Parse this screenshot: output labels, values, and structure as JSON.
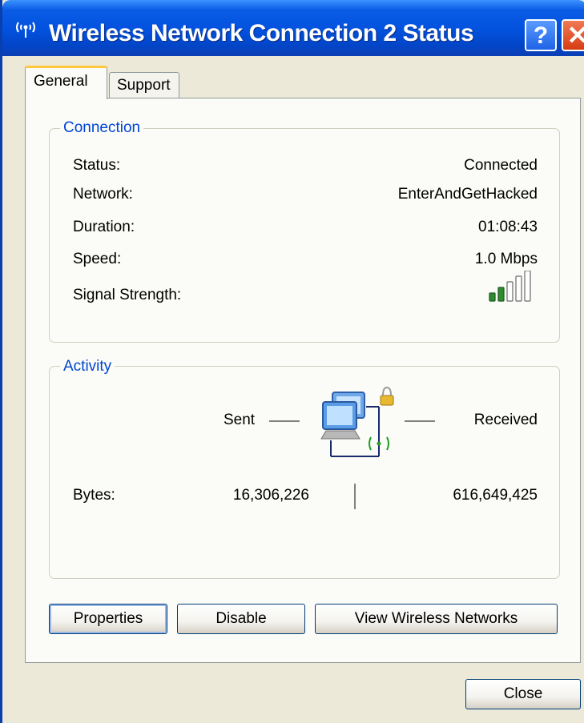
{
  "window": {
    "title": "Wireless Network Connection 2 Status",
    "help_label": "?",
    "close_label": "✕"
  },
  "tabs": [
    {
      "label": "General",
      "active": true
    },
    {
      "label": "Support",
      "active": false
    }
  ],
  "connection": {
    "legend": "Connection",
    "rows": [
      {
        "label": "Status:",
        "value": "Connected"
      },
      {
        "label": "Network:",
        "value": "EnterAndGetHacked"
      },
      {
        "label": "Duration:",
        "value": "01:08:43"
      },
      {
        "label": "Speed:",
        "value": "1.0 Mbps"
      }
    ],
    "signal_label": "Signal Strength:",
    "signal_bars_filled": 2,
    "signal_bars_total": 5
  },
  "activity": {
    "legend": "Activity",
    "sent_label": "Sent",
    "received_label": "Received",
    "bytes_label": "Bytes:",
    "bytes_sent": "16,306,226",
    "bytes_received": "616,649,425"
  },
  "buttons": {
    "properties": "Properties",
    "disable": "Disable",
    "view_networks": "View Wireless Networks",
    "close": "Close"
  },
  "colors": {
    "titlebar": "#0353e0",
    "legend_text": "#0046d5",
    "signal_green": "#2e8b2e"
  }
}
